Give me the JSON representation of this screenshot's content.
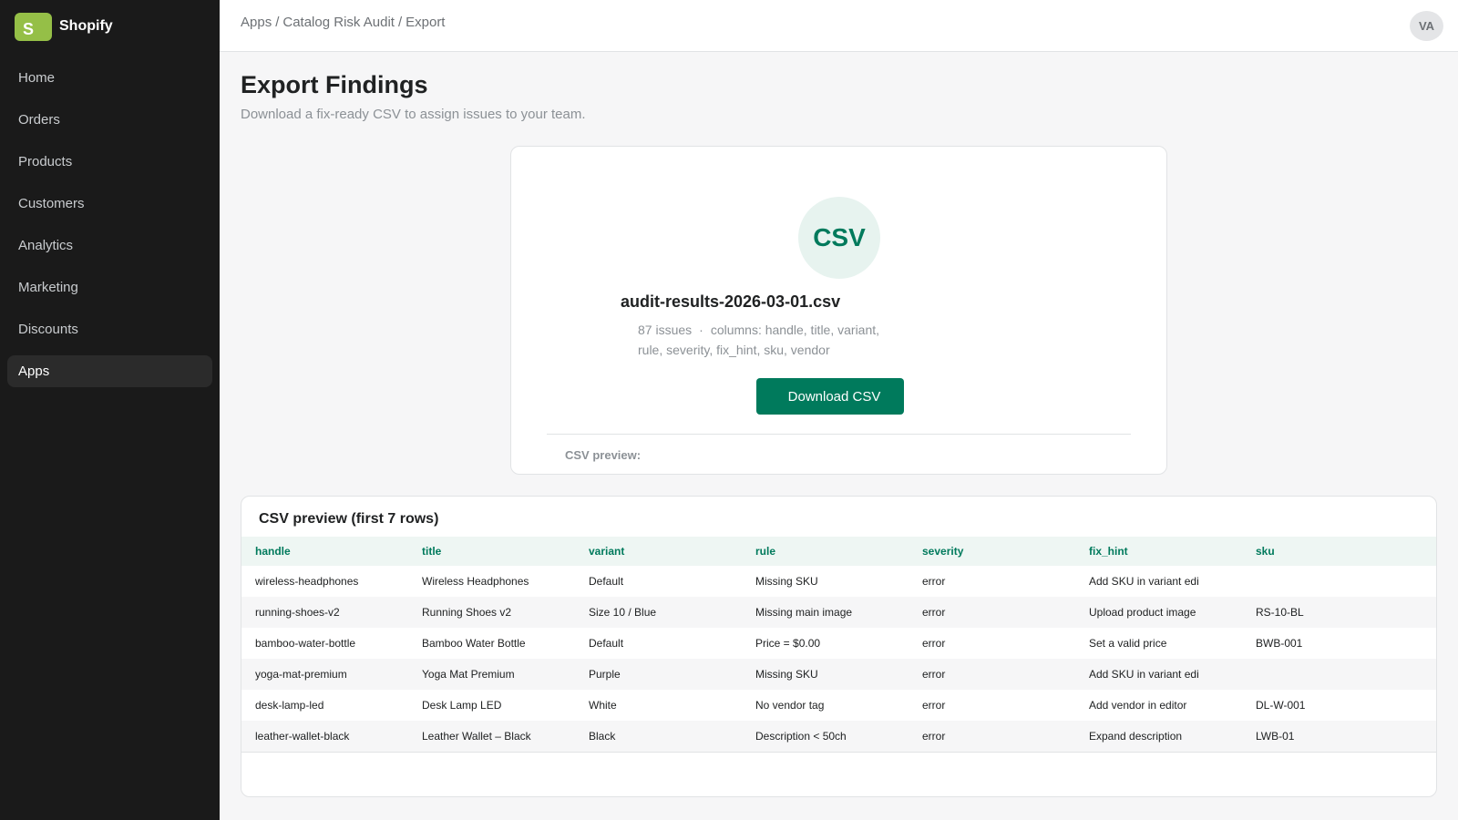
{
  "brand": {
    "logo_letter": "S",
    "name": "Shopify",
    "color": "#95bf47"
  },
  "sidebar": {
    "items": [
      {
        "label": "Home"
      },
      {
        "label": "Orders"
      },
      {
        "label": "Products"
      },
      {
        "label": "Customers"
      },
      {
        "label": "Analytics"
      },
      {
        "label": "Marketing"
      },
      {
        "label": "Discounts"
      },
      {
        "label": "Apps",
        "active": true
      }
    ]
  },
  "header": {
    "breadcrumb": [
      "Apps",
      "Catalog Risk Audit",
      "Export"
    ],
    "breadcrumb_separator": "/",
    "avatar_initials": "VA"
  },
  "page": {
    "title": "Export Findings",
    "subtitle": "Download a fix-ready CSV to assign issues to your team."
  },
  "export_card": {
    "icon_label": "CSV",
    "file_name": "audit-results-2026-03-01.csv",
    "issue_count": "87 issues",
    "separator": "·",
    "columns_text": "columns: handle, title, variant, rule, severity, fix_hint, sku, vendor",
    "download_icon": "download-icon",
    "download_icon_glyph": "",
    "download_label": "Download CSV",
    "preview_caption": "CSV preview:",
    "accent_color": "#007a5c"
  },
  "preview_table": {
    "title": "CSV preview (first 7 rows)",
    "columns": [
      "handle",
      "title",
      "variant",
      "rule",
      "severity",
      "fix_hint",
      "sku"
    ],
    "rows": [
      [
        "wireless-headphones",
        "Wireless Headphones",
        "Default",
        "Missing SKU",
        "error",
        "Add SKU in variant edi",
        ""
      ],
      [
        "running-shoes-v2",
        "Running Shoes v2",
        "Size 10 / Blue",
        "Missing main image",
        "error",
        "Upload product image",
        "RS-10-BL"
      ],
      [
        "bamboo-water-bottle",
        "Bamboo Water Bottle",
        "Default",
        "Price = $0.00",
        "error",
        "Set a valid price",
        "BWB-001"
      ],
      [
        "yoga-mat-premium",
        "Yoga Mat Premium",
        "Purple",
        "Missing SKU",
        "error",
        "Add SKU in variant edi",
        ""
      ],
      [
        "desk-lamp-led",
        "Desk Lamp LED",
        "White",
        "No vendor tag",
        "error",
        "Add vendor in editor",
        "DL-W-001"
      ],
      [
        "leather-wallet-black",
        "Leather Wallet – Black",
        "Black",
        "Description < 50ch",
        "error",
        "Expand description",
        "LWB-01"
      ]
    ]
  }
}
